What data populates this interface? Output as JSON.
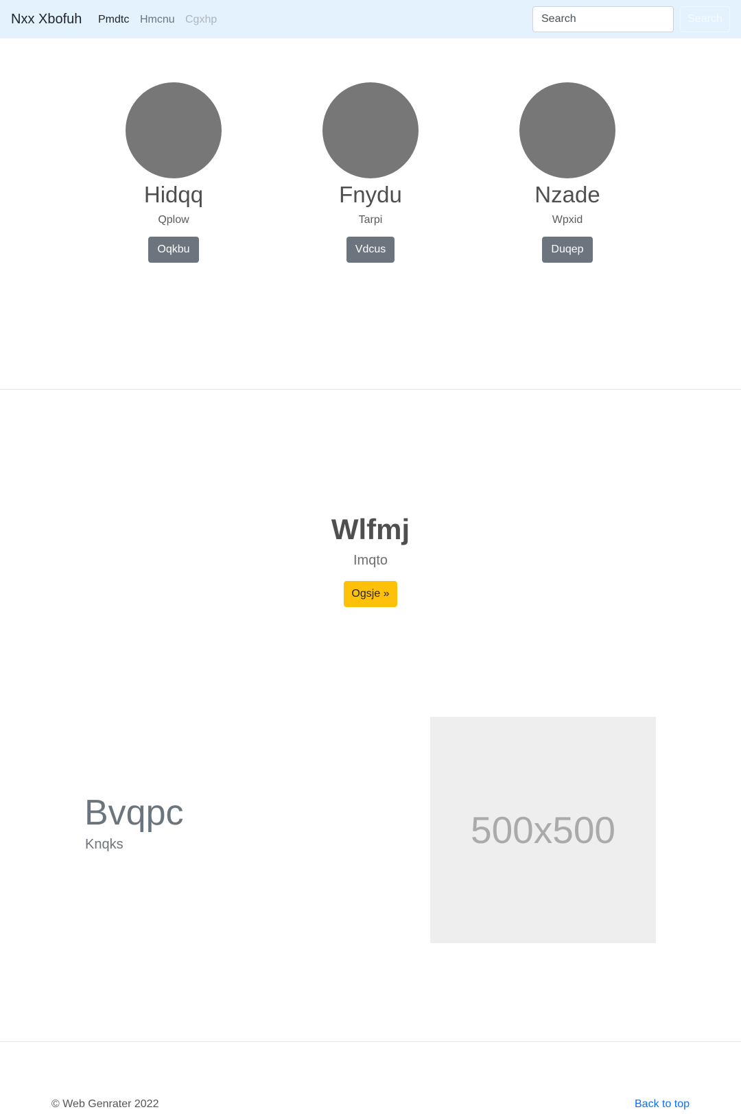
{
  "navbar": {
    "brand": "Nxx Xbofuh",
    "links": [
      {
        "label": "Pmdtc",
        "state": "active"
      },
      {
        "label": "Hmcnu",
        "state": "normal"
      },
      {
        "label": "Cgxhp",
        "state": "disabled"
      }
    ],
    "search": {
      "placeholder": "Search",
      "button_label": "Search"
    }
  },
  "people": [
    {
      "name": "Hidqq",
      "role": "Qplow",
      "button_label": "Oqkbu"
    },
    {
      "name": "Fnydu",
      "role": "Tarpi",
      "button_label": "Vdcus"
    },
    {
      "name": "Nzade",
      "role": "Wpxid",
      "button_label": "Duqep"
    }
  ],
  "feature": {
    "title": "Wlfmj",
    "subtitle": "Imqto",
    "button_label": "Ogsje »"
  },
  "showcase": {
    "title": "Bvqpc",
    "subtitle": "Knqks",
    "image_placeholder": "500x500"
  },
  "footer": {
    "copyright": "© Web Genrater 2022",
    "back_to_top": "Back to top"
  },
  "colors": {
    "navbar_background": "#e3f2fd",
    "secondary_button": "#6c757d",
    "warning_button": "#ffc107",
    "avatar": "#777777",
    "link": "#0d6efd"
  }
}
